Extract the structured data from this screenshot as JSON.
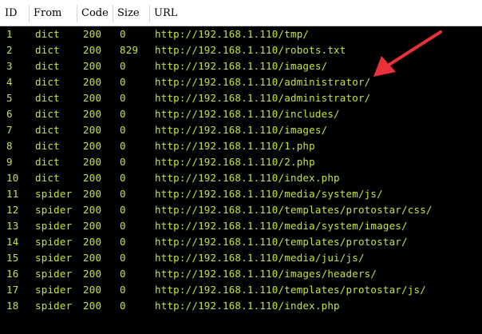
{
  "table": {
    "columns": [
      "ID",
      "From",
      "Code",
      "Size",
      "URL"
    ],
    "rows": [
      {
        "id": "1",
        "from": "dict",
        "code": "200",
        "size": "0",
        "url": "http://192.168.1.110/tmp/"
      },
      {
        "id": "2",
        "from": "dict",
        "code": "200",
        "size": "829",
        "url": "http://192.168.1.110/robots.txt"
      },
      {
        "id": "3",
        "from": "dict",
        "code": "200",
        "size": "0",
        "url": "http://192.168.1.110/images/"
      },
      {
        "id": "4",
        "from": "dict",
        "code": "200",
        "size": "0",
        "url": "http://192.168.1.110/administrator/"
      },
      {
        "id": "5",
        "from": "dict",
        "code": "200",
        "size": "0",
        "url": "http://192.168.1.110/administrator/"
      },
      {
        "id": "6",
        "from": "dict",
        "code": "200",
        "size": "0",
        "url": "http://192.168.1.110/includes/"
      },
      {
        "id": "7",
        "from": "dict",
        "code": "200",
        "size": "0",
        "url": "http://192.168.1.110/images/"
      },
      {
        "id": "8",
        "from": "dict",
        "code": "200",
        "size": "0",
        "url": "http://192.168.1.110/1.php"
      },
      {
        "id": "9",
        "from": "dict",
        "code": "200",
        "size": "0",
        "url": "http://192.168.1.110/2.php"
      },
      {
        "id": "10",
        "from": "dict",
        "code": "200",
        "size": "0",
        "url": "http://192.168.1.110/index.php"
      },
      {
        "id": "11",
        "from": "spider",
        "code": "200",
        "size": "0",
        "url": "http://192.168.1.110/media/system/js/"
      },
      {
        "id": "12",
        "from": "spider",
        "code": "200",
        "size": "0",
        "url": "http://192.168.1.110/templates/protostar/css/"
      },
      {
        "id": "13",
        "from": "spider",
        "code": "200",
        "size": "0",
        "url": "http://192.168.1.110/media/system/images/"
      },
      {
        "id": "14",
        "from": "spider",
        "code": "200",
        "size": "0",
        "url": "http://192.168.1.110/templates/protostar/"
      },
      {
        "id": "15",
        "from": "spider",
        "code": "200",
        "size": "0",
        "url": "http://192.168.1.110/media/jui/js/"
      },
      {
        "id": "16",
        "from": "spider",
        "code": "200",
        "size": "0",
        "url": "http://192.168.1.110/images/headers/"
      },
      {
        "id": "17",
        "from": "spider",
        "code": "200",
        "size": "0",
        "url": "http://192.168.1.110/templates/protostar/js/"
      },
      {
        "id": "18",
        "from": "spider",
        "code": "200",
        "size": "0",
        "url": "http://192.168.1.110/index.php"
      }
    ]
  },
  "colors": {
    "background": "#000000",
    "text": "#c8e23a",
    "header_background": "#ffffff",
    "header_text": "#000000",
    "annotation_arrow": "#e8313b"
  },
  "annotation": {
    "icon": "red-arrow-icon",
    "points_to_row": "4"
  }
}
